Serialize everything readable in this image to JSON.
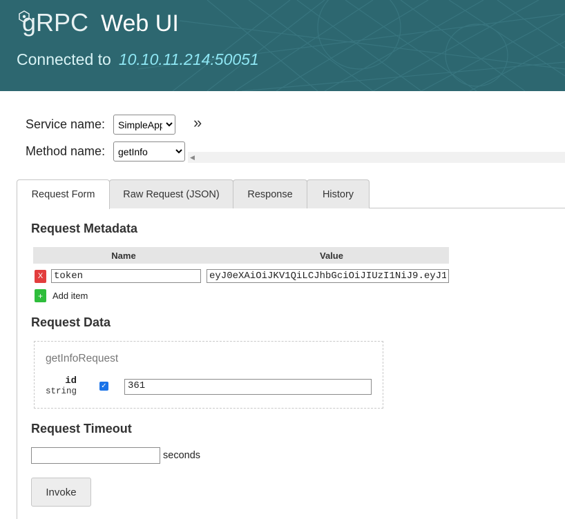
{
  "header": {
    "logo_text": "gRPC",
    "title": "Web UI",
    "connected_label": "Connected to",
    "address": "10.10.11.214:50051",
    "bg_color": "#2d6770"
  },
  "service": {
    "label": "Service name:",
    "selected": "SimpleApp"
  },
  "method": {
    "label": "Method name:",
    "selected": "getInfo"
  },
  "expand_icon": "»",
  "tabs": [
    {
      "label": "Request Form",
      "active": true
    },
    {
      "label": "Raw Request (JSON)",
      "active": false
    },
    {
      "label": "Response",
      "active": false
    },
    {
      "label": "History",
      "active": false
    }
  ],
  "metadata": {
    "heading": "Request Metadata",
    "col_name": "Name",
    "col_value": "Value",
    "rows": [
      {
        "remove_icon": "X",
        "name": "token",
        "value": "eyJ0eXAiOiJKV1QiLCJhbGciOiJIUzI1NiJ9.eyJ1"
      }
    ],
    "add_icon": "+",
    "add_label": "Add item"
  },
  "request_data": {
    "heading": "Request Data",
    "message_name": "getInfoRequest",
    "fields": [
      {
        "name": "id",
        "type": "string",
        "checked": true,
        "value": "361"
      }
    ]
  },
  "timeout": {
    "heading": "Request Timeout",
    "value": "",
    "unit": "seconds"
  },
  "invoke_label": "Invoke"
}
